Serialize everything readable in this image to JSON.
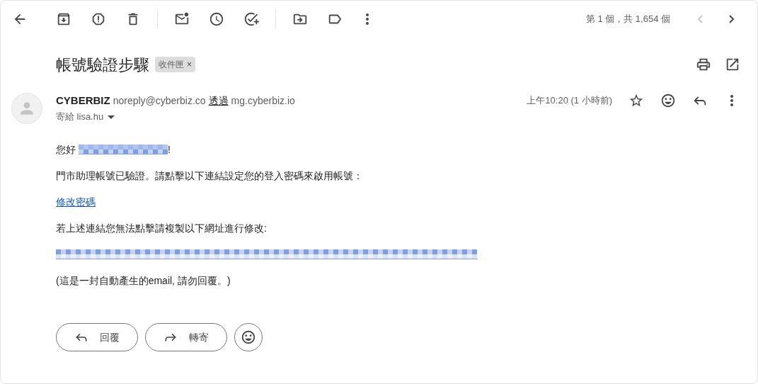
{
  "pager": {
    "text": "第 1 個，共 1,654 個",
    "prev_enabled": false,
    "next_enabled": true
  },
  "subject": {
    "title": "帳號驗證步驟",
    "label": "收件匣",
    "label_close": "×"
  },
  "message": {
    "sender_name": "CYBERBIZ",
    "sender_email": "noreply@cyberbiz.co",
    "via": "透過",
    "via_domain": "mg.cyberbiz.io",
    "to": "寄給 lisa.hu",
    "time": "上午10:20 (1 小時前)",
    "starred": false
  },
  "body": {
    "greeting": "您好",
    "greeting_end": "!",
    "intro": "門市助理帳號已驗證。請點擊以下連結設定您的登入密碼來啟用帳號：",
    "link": "修改密碼",
    "fallback": "若上述連結您無法點擊請複製以下網址進行修改:",
    "footer": "(這是一封自動產生的email, 請勿回覆。)"
  },
  "actions": [
    {
      "kind": "reply",
      "label": "回覆"
    },
    {
      "kind": "forward",
      "label": "轉寄"
    },
    {
      "kind": "emoji"
    }
  ]
}
